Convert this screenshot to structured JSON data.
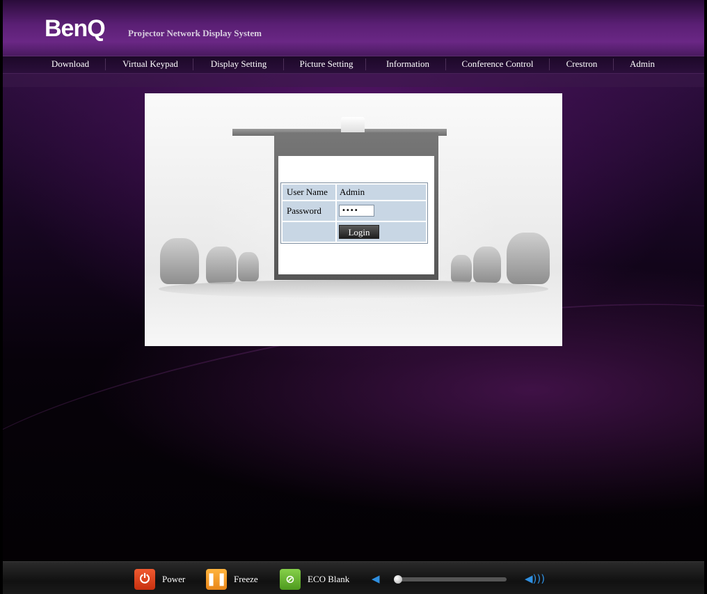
{
  "header": {
    "logo": "BenQ",
    "system_title": "Projector Network Display System"
  },
  "nav": {
    "items": [
      {
        "label": "Download"
      },
      {
        "label": "Virtual Keypad"
      },
      {
        "label": "Display Setting"
      },
      {
        "label": "Picture Setting"
      },
      {
        "label": "Information"
      },
      {
        "label": "Conference Control"
      },
      {
        "label": "Crestron"
      },
      {
        "label": "Admin"
      }
    ]
  },
  "login": {
    "username_label": "User Name",
    "username_value": "Admin",
    "password_label": "Password",
    "password_value": "••••",
    "login_button": "Login"
  },
  "footer": {
    "power_label": "Power",
    "freeze_label": "Freeze",
    "eco_blank_label": "ECO Blank",
    "volume_level": 0,
    "colors": {
      "power": "#e0401c",
      "freeze": "#f39a1e",
      "eco_blank": "#6ab82e",
      "volume_icon": "#2f8fe0"
    },
    "icons": {
      "power": "power-icon",
      "freeze": "pause-icon",
      "eco_blank": "eco-blank-icon",
      "volume_down": "volume-down-icon",
      "volume_up": "volume-up-icon"
    }
  }
}
